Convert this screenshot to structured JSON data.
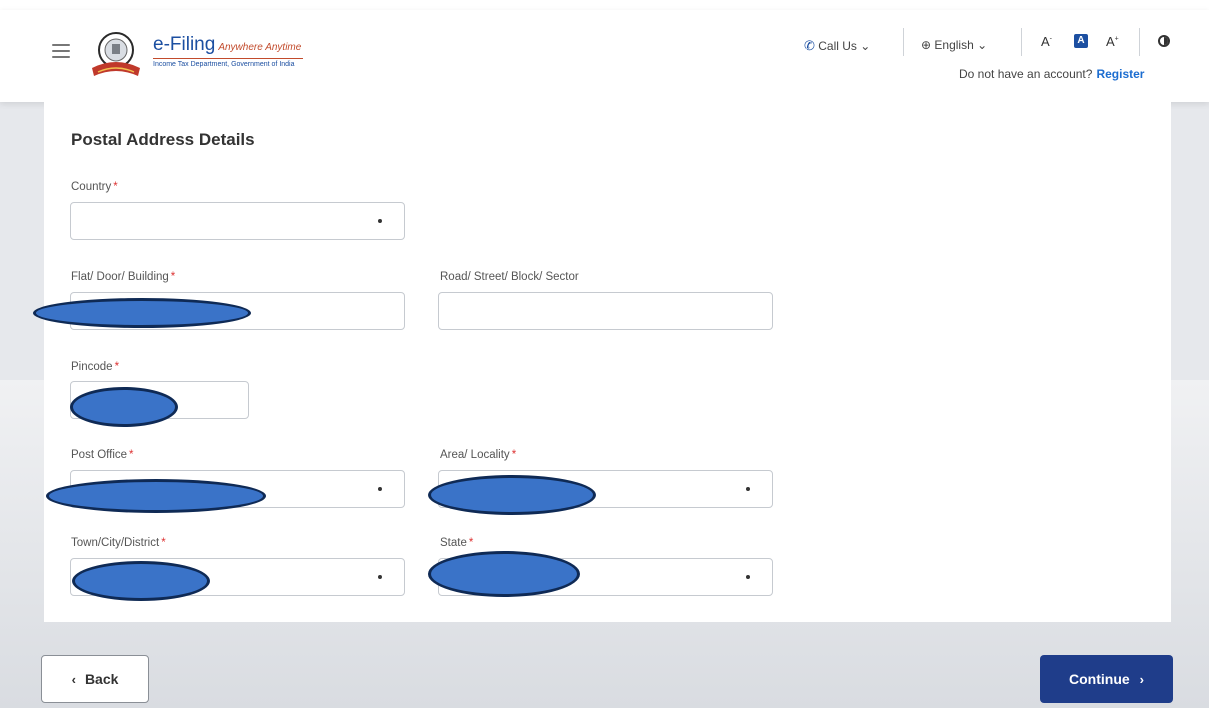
{
  "header": {
    "brand_title": "e-Filing",
    "brand_tagline": "Anywhere Anytime",
    "brand_subtitle": "Income Tax Department, Government of India",
    "call_us": "Call Us",
    "language": "English",
    "font_decrease": "A",
    "font_normal": "A",
    "font_increase": "A",
    "account_prompt": "Do not have an account?",
    "register_link": "Register",
    "icons": [
      "menu-icon",
      "emblem-logo",
      "phone-icon",
      "globe-icon",
      "chevron-down-icon",
      "contrast-icon"
    ]
  },
  "form": {
    "section_title": "Postal Address Details",
    "required_mark": "*",
    "fields": {
      "country": {
        "label": "Country",
        "value": ""
      },
      "flat": {
        "label": "Flat/ Door/ Building",
        "value": ""
      },
      "road": {
        "label": "Road/ Street/ Block/ Sector",
        "value": ""
      },
      "pincode": {
        "label": "Pincode",
        "value": ""
      },
      "post_office": {
        "label": "Post Office",
        "value": ""
      },
      "area": {
        "label": "Area/ Locality",
        "value": ""
      },
      "town": {
        "label": "Town/City/District",
        "value": ""
      },
      "state": {
        "label": "State",
        "value": ""
      }
    }
  },
  "footer": {
    "back_label": "Back",
    "continue_label": "Continue"
  },
  "colors": {
    "brand_blue": "#1c4fa1",
    "primary_button": "#1f3d8a",
    "redaction_fill": "#3a73c8",
    "required": "#dd3333"
  }
}
